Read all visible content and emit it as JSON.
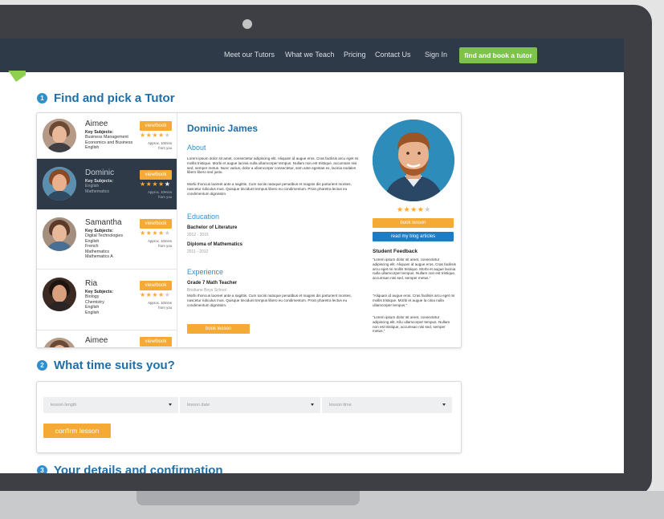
{
  "nav": {
    "items": [
      "Meet our Tutors",
      "What we Teach",
      "Pricing",
      "Contact Us",
      "Sign In"
    ],
    "cta": "find and book a tutor"
  },
  "steps": [
    {
      "number": "1",
      "title": "Find and pick a Tutor"
    },
    {
      "number": "2",
      "title": "What time suits you?"
    },
    {
      "number": "3",
      "title": "Your details and confirmation"
    }
  ],
  "tutors": [
    {
      "name": "Aimee",
      "key_subjects_label": "Key Subjects:",
      "subjects": [
        "Business Management",
        "Economics and Business",
        "English"
      ],
      "view_label": "view/book",
      "rating": 4,
      "distance": [
        "Approx. 10mins",
        "from you"
      ],
      "active": false
    },
    {
      "name": "Dominic",
      "key_subjects_label": "Key Subjects:",
      "subjects": [
        "English",
        "Mathematics"
      ],
      "view_label": "view/book",
      "rating": 4,
      "distance": [
        "Approx. 10mins",
        "from you"
      ],
      "active": true
    },
    {
      "name": "Samantha",
      "key_subjects_label": "Key Subjects:",
      "subjects": [
        "Digital Technologies",
        "English",
        "French",
        "Mathematics",
        "Mathematics A"
      ],
      "view_label": "view/book",
      "rating": 4,
      "distance": [
        "Approx. 10mins",
        "from you"
      ],
      "active": false
    },
    {
      "name": "Ria",
      "key_subjects_label": "Key Subjects:",
      "subjects": [
        "Biology",
        "Chemistry",
        "English",
        "English"
      ],
      "view_label": "view/book",
      "rating": 4,
      "distance": [
        "Approx. 10mins",
        "from you"
      ],
      "active": false
    },
    {
      "name": "Aimee",
      "key_subjects_label": "",
      "subjects": [],
      "view_label": "view/book",
      "rating": 0,
      "distance": [],
      "active": false
    }
  ],
  "profile": {
    "name": "Dominic James",
    "about_title": "About",
    "about_p1": "Lorem ipsum dolor sit amet, consectetur adipiscing elit. Aliquam id augue eros. Cras facilisis arcu eget mi mollis tristique. Morbi et augue lacinia nulla ullamcorper tempus. Nullam non est tristique, accumsan nisi sed, semper metus. Nunc varius, dolor a ullamcorper consectetur, sem ante egestas ex, lacinia sodales libero libero sed justo.",
    "about_p2": "Morbi rhoncus laoreet ante a sagittis. Cum sociis natoque penatibus et magnis dis parturient montes, nascetur ridiculus mus. Quisque tincidunt tempus libero eu condimentum. Proin pharetra lectus eu condimentum dignissim.",
    "education_title": "Education",
    "education": [
      {
        "degree": "Bachelor of Literature",
        "years": "2012 - 2015"
      },
      {
        "degree": "Diploma of Mathematics",
        "years": "2011 - 2012"
      }
    ],
    "experience_title": "Experience",
    "experience": {
      "role": "Grade 7 Math Teacher",
      "school": "Brisbane Boys School",
      "text": "Morbi rhoncus laoreet ante a sagittis. Cum sociis natoque penatibus et magnis dis parturient montes, nascetur ridiculus mus. Quisque tincidunt tempus libero eu condimentum. Proin pharetra lectus eu condimentum dignissim."
    },
    "book_label": "book lesson",
    "rating": 4,
    "side_book_label": "book lesson",
    "blog_label": "read my blog articles",
    "feedback_title": "Student Feedback",
    "feedback": [
      "\"Lorem ipsum dolor sit amet, consectetur adipiscing elit. Aliquam id augue eros. Cras facilisis arcu eget mi mollis tristique. Morbi et augue lacinia nulla ullamcorper tempus. Nullam non est tristique, accumsan nisi sed, semper metus.\"",
      "\"Aliquam id augue eros. Cras facilisis arcu eget mi mollis tristique. Morbi et augue la cinia nulla ullamcorper tempus.\"",
      "\"Lorem ipsum dolor sit amet, consectetur adipiscing elit. Kilu ullamcorper tempus. Nullam non est tristique, accumsan nisi sed, semper metus.\""
    ]
  },
  "schedule": {
    "fields": [
      "lesson length",
      "lesson date",
      "lesson time"
    ],
    "confirm_label": "confirm lesson"
  },
  "colors": {
    "nav": "#2e3a48",
    "accent_orange": "#f5aa35",
    "accent_green": "#7dc24a",
    "heading_blue": "#1f6ea6",
    "button_blue": "#1f7cc0"
  }
}
